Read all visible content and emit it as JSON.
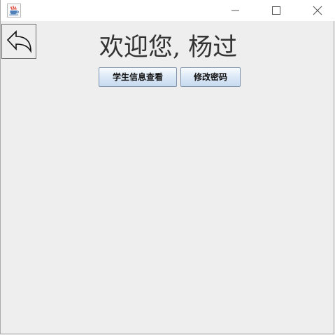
{
  "window": {
    "controls": {
      "minimize_icon": "minimize-icon",
      "maximize_icon": "maximize-icon",
      "close_icon": "close-icon"
    }
  },
  "main": {
    "welcome_text": "欢迎您, 杨过",
    "buttons": {
      "student_info": "学生信息查看",
      "change_password": "修改密码"
    },
    "back_icon": "back-arrow-icon"
  },
  "colors": {
    "background": "#eeeeee",
    "titlebar": "#ffffff",
    "button_border": "#7f93ad",
    "button_gradient_top": "#f8fbff",
    "button_gradient_bottom": "#c7daf0"
  }
}
